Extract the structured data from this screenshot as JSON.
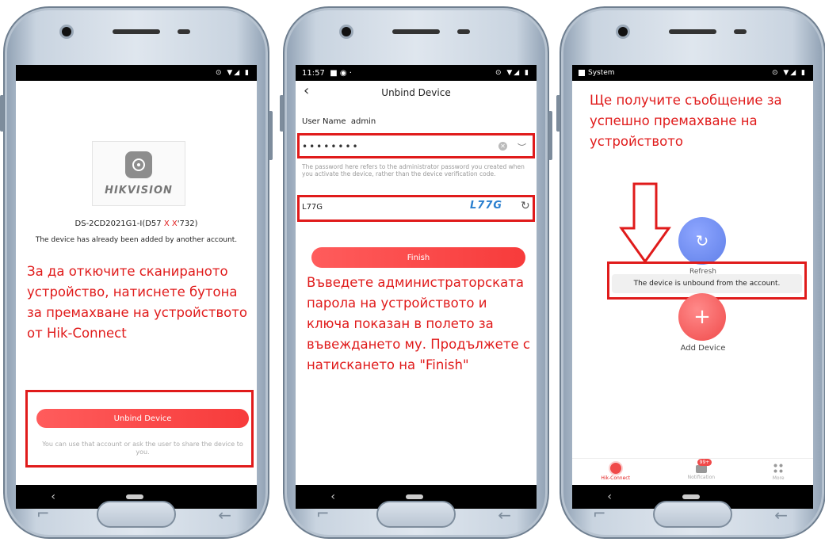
{
  "phone1": {
    "status_icons": "⊙ ▼◢ ▮",
    "brand": "HIKVISION",
    "model_prefix": "DS-2CD2021G1-I(D57 ",
    "model_masked": "X X",
    "model_suffix": "'732)",
    "added_text": "The device has already been added by another account.",
    "instruction": "За да откючите сканираното устройство, натиснете бутона за премахване на устройството от Hik-Connect",
    "unbind_button": "Unbind Device",
    "hint": "You can use that account or ask the user to share the device to you."
  },
  "phone2": {
    "status_time": "11:57",
    "status_left_icons": "■ ◉ ·",
    "status_icons": "⊙ ▼◢ ▮",
    "back_icon": "‹",
    "title": "Unbind Device",
    "user_label": "User Name",
    "user_value": "admin",
    "password_value": "••••••••",
    "clear_icon": "✕",
    "eye_icon": "︶",
    "password_note": "The password here refers to the administrator password you created when you activate the device, rather than the device verification code.",
    "code_value": "L77G",
    "captcha_text": "L77G",
    "refresh_icon": "↻",
    "finish_button": "Finish",
    "instruction": "Въведете администраторската парола на устройството и ключа показан в полето за въвеждането му. Продължете с натискането на \"Finish\""
  },
  "phone3": {
    "status_app": "System",
    "status_icons": "⊙ ▼◢ ▮",
    "instruction": "Ще получите съобщение за успешно премахване на устройството",
    "refresh_icon": "↻",
    "refresh_label": "Refresh",
    "toast": "The device is unbound from the account.",
    "add_icon": "+",
    "add_label": "Add Device",
    "tabs": [
      {
        "label": "Hik-Connect"
      },
      {
        "label": "Notification",
        "badge": "99+"
      },
      {
        "label": "More"
      }
    ]
  },
  "android_nav": {
    "back": "‹"
  },
  "hardware": {
    "recent": "⌐",
    "back": "←"
  },
  "colors": {
    "accent_red": "#e01b1b",
    "button_red": "#f73b3b",
    "refresh_blue": "#5f7fe8"
  }
}
